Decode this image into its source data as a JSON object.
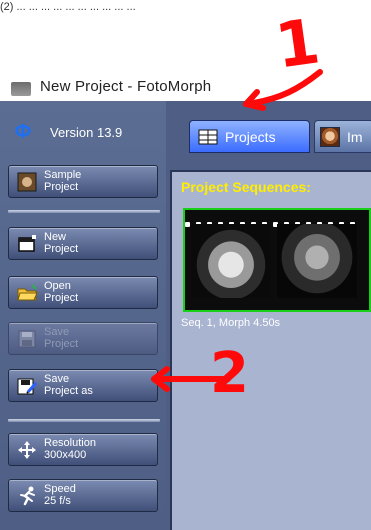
{
  "window": {
    "partial_top_text": "(2) ... ... ... ... ... ... ... ... ... ...",
    "title": "New Project - FotoMorph"
  },
  "sidebar": {
    "version": "Version 13.9",
    "buttons": [
      {
        "label": "Sample\nProject",
        "state": "enabled",
        "icon": "portrait-icon"
      },
      {
        "label": "New\nProject",
        "state": "enabled",
        "icon": "new-project-icon"
      },
      {
        "label": "Open\nProject",
        "state": "enabled",
        "icon": "open-folder-icon"
      },
      {
        "label": "Save\nProject",
        "state": "disabled",
        "icon": "save-icon"
      },
      {
        "label": "Save\nProject as",
        "state": "enabled",
        "icon": "save-as-icon"
      },
      {
        "label": "Resolution\n300x400",
        "state": "enabled",
        "icon": "move-icon"
      },
      {
        "label": "Speed\n25 f/s",
        "state": "enabled",
        "icon": "running-icon"
      }
    ]
  },
  "tabs": [
    {
      "label": "Projects",
      "active": true,
      "icon": "grid-icon"
    },
    {
      "label": "Im",
      "active": false,
      "icon": "image-tab-icon"
    }
  ],
  "main": {
    "sequences_title": "Project Sequences:",
    "sequence_caption": "Seq. 1,  Morph 4.50s"
  },
  "annotations": {
    "one": "1",
    "two": "2"
  },
  "colors": {
    "sidebar_bg": "#5b6d93",
    "panel_bg": "#a9b4d1",
    "title_text": "#ffee00",
    "accent_tab": "#3b6cff",
    "selection_border": "#17d017",
    "annotation_red": "#ff0a0a"
  }
}
